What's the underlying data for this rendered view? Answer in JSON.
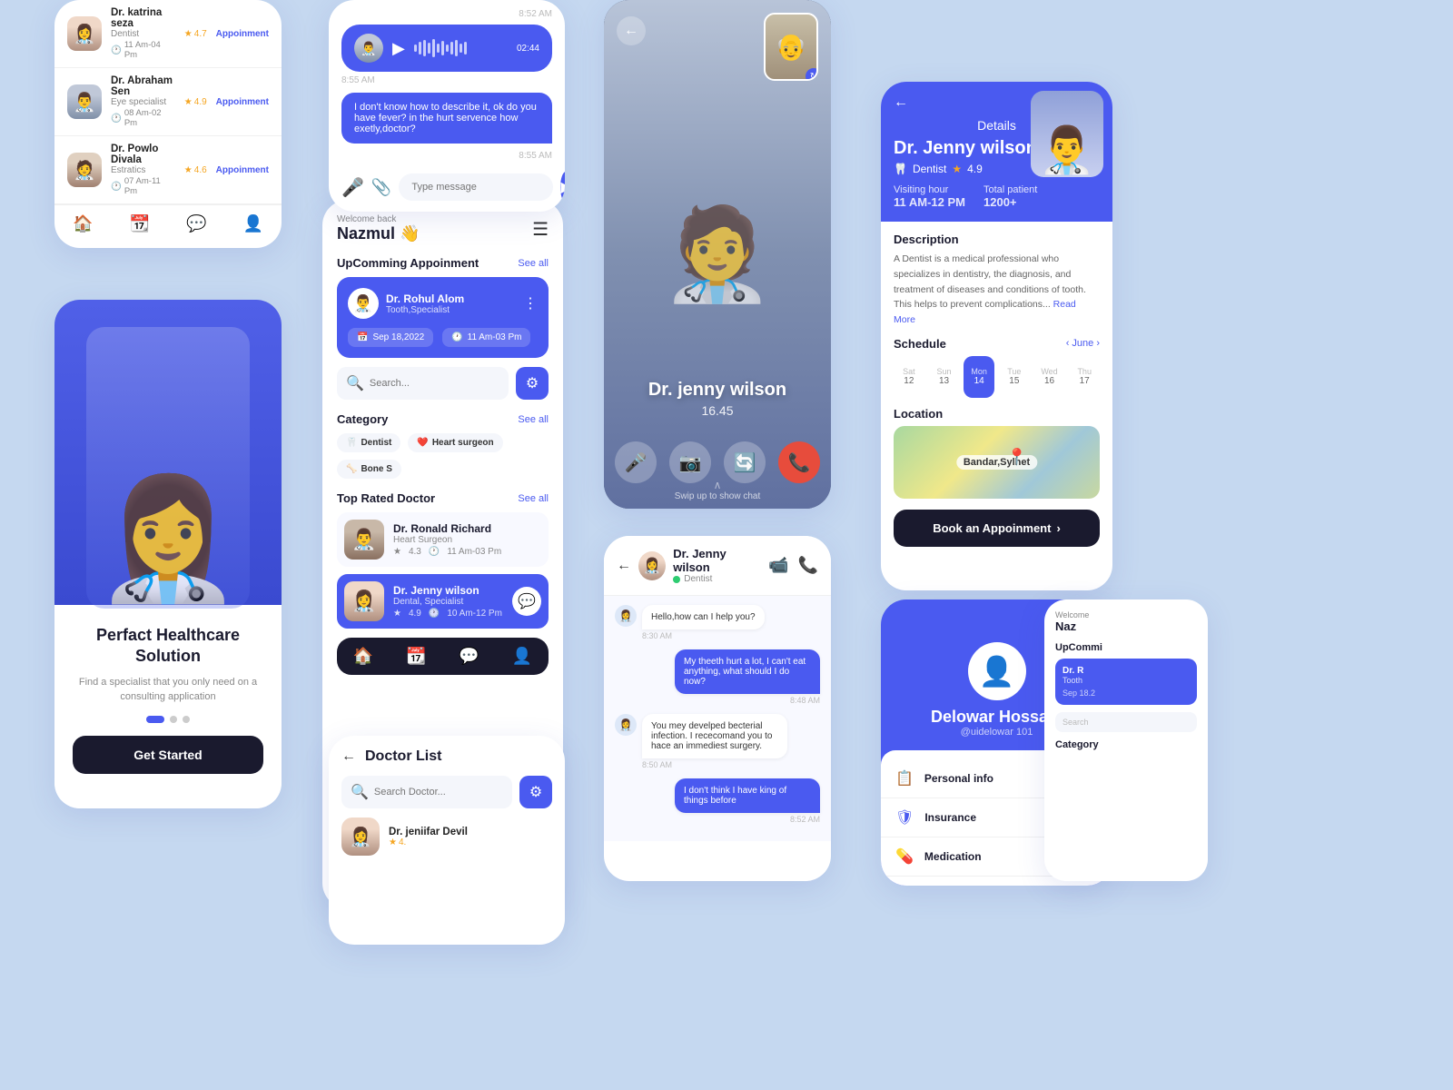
{
  "card_doctor_list": {
    "doctors": [
      {
        "name": "Dr. katrina seza",
        "specialty": "Dentist",
        "time": "11 Am-04 Pm",
        "rating": "4.7",
        "btn": "Appoinment"
      },
      {
        "name": "Dr. Abraham Sen",
        "specialty": "Eye specialist",
        "time": "08 Am-02 Pm",
        "rating": "4.9",
        "btn": "Appoinment"
      },
      {
        "name": "Dr. Powlo Divala",
        "specialty": "Estratics",
        "time": "07 Am-11 Pm",
        "rating": "4.6",
        "btn": "Appoinment"
      }
    ]
  },
  "card_splash": {
    "title": "Perfact Healthcare Solution",
    "subtitle": "Find a specialist that you only need on a consulting application",
    "btn_label": "Get Started"
  },
  "card_home": {
    "welcome_text": "Welcome back",
    "user_name": "Nazmul 👋",
    "upcoming_label": "UpComming Appoinment",
    "see_all": "See all",
    "appointment": {
      "doctor": "Dr. Rohul Alom",
      "specialty": "Tooth,Specialist",
      "date": "Sep 18,2022",
      "time": "11 Am-03 Pm"
    },
    "search_placeholder": "Search...",
    "category_label": "Category",
    "categories": [
      "Dentist",
      "Heart surgeon",
      "Bone S"
    ],
    "top_rated_label": "Top Rated Doctor",
    "top_doctors": [
      {
        "name": "Dr. Ronald Richard",
        "specialty": "Heart Surgeon",
        "rating": "4.3",
        "time": "11 Am-03 Pm"
      },
      {
        "name": "Dr. Jenny wilson",
        "specialty": "Dental, Specialist",
        "rating": "4.9",
        "time": "10 Am-12 Pm"
      }
    ]
  },
  "card_audio": {
    "time1": "8:52 AM",
    "time2": "8:55 AM",
    "duration": "02:44",
    "message1": "I don't know how to describe it, ok do you have fever? in the hurt servence how exetly,doctor?",
    "msg_time2": "8:55 AM",
    "placeholder": "Type message"
  },
  "card_video": {
    "doctor_name": "Dr. jenny wilson",
    "call_time": "16.45",
    "swipe_text": "Swip up to show chat"
  },
  "card_chat": {
    "doctor_name": "Dr. Jenny wilson",
    "specialty": "Dentist",
    "messages": [
      {
        "text": "Hello,how can I help you?",
        "time": "8:30 AM",
        "sent": false
      },
      {
        "text": "My theeth hurt a lot, I can't eat anything, what should I do now?",
        "time": "8:48 AM",
        "sent": true
      },
      {
        "text": "You mey develped becterial infection. I rececomand you to hace an immediest surgery.",
        "time": "8:50 AM",
        "sent": false
      },
      {
        "text": "I don't think I have king of things before",
        "time": "8:52 AM",
        "sent": true
      }
    ]
  },
  "card_details": {
    "back_label": "←",
    "title": "Details",
    "doctor_name": "Dr. Jenny wilson",
    "specialty": "Dentist",
    "rating": "4.9",
    "visiting_hour_label": "Visiting hour",
    "visiting_hour": "11 AM-12 PM",
    "total_patient_label": "Total patient",
    "total_patient": "1200+",
    "description_title": "Description",
    "description": "A Dentist is a medical professional who specializes in dentistry, the diagnosis, and treatment of diseases and conditions of tooth. This helps to prevent complications...",
    "read_more": "Read More",
    "schedule_label": "Schedule",
    "month": "‹ June ›",
    "dates": [
      {
        "day": "Sat",
        "num": "12"
      },
      {
        "day": "Sun",
        "num": "13"
      },
      {
        "day": "Mon",
        "num": "14",
        "active": true
      },
      {
        "day": "Tue",
        "num": "15"
      },
      {
        "day": "Wed",
        "num": "16"
      },
      {
        "day": "Thu",
        "num": "17"
      }
    ],
    "location_label": "Location",
    "map_city": "Bandar,Sylhet",
    "book_btn": "Book an Appoinment"
  },
  "card_profile": {
    "user_name": "Delowar Hossain",
    "handle": "@uidelowar 101",
    "menu_items": [
      {
        "icon": "📋",
        "label": "Personal info"
      },
      {
        "icon": "🛡",
        "label": "Insurance"
      },
      {
        "icon": "💊",
        "label": "Medication"
      }
    ]
  },
  "card_doctor_list2": {
    "title": "Doctor List",
    "search_placeholder": "Search Doctor...",
    "doctors": [
      {
        "name": "Dr. jeniifar Devil",
        "rating": "4."
      }
    ]
  },
  "bg_right": {
    "welcome": "Welcome",
    "name": "Naz",
    "upcoming": "UpCommi",
    "doc_name": "Dr. R",
    "doc_spec": "Tooth",
    "date": "Sep 18.2",
    "search_placeholder": "Search",
    "category": "Category"
  },
  "icons": {
    "back": "←",
    "star": "★",
    "clock": "🕐",
    "calendar": "📅",
    "mic": "🎤",
    "video": "📹",
    "refresh": "🔄",
    "phone_end": "📞",
    "search": "🔍",
    "filter": "⚙",
    "send": "▶",
    "home": "🏠",
    "calendar2": "📆",
    "chat": "💬",
    "person": "👤",
    "tooth": "🦷",
    "heart": "❤️",
    "bone": "🦴",
    "attach": "📎",
    "map_pin": "📍"
  }
}
